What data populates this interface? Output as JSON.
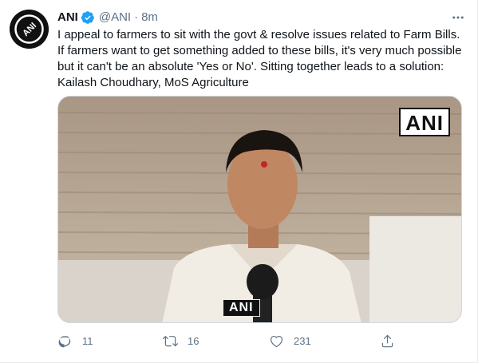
{
  "tweet": {
    "author": {
      "name": "ANI",
      "handle": "@ANI",
      "separator": "·",
      "time": "8m",
      "avatar_text": "ANI",
      "verified_icon": "verified-badge-icon"
    },
    "text_lines": [
      "I appeal to farmers to sit with the govt & resolve issues related to Farm Bills.",
      "If farmers want to get something added to these bills, it's very much possible",
      "but it can't be an absolute 'Yes or No'. Sitting together leads to a solution:",
      "Kailash Choudhary, MoS Agriculture"
    ],
    "media": {
      "watermark": "ANI",
      "mic_label": "ANI"
    },
    "actions": {
      "reply_count": "11",
      "retweet_count": "16",
      "like_count": "231"
    }
  },
  "colors": {
    "text_primary": "#0f1419",
    "text_secondary": "#5b7083",
    "verified": "#1da1f2",
    "border": "#cfd9de"
  }
}
